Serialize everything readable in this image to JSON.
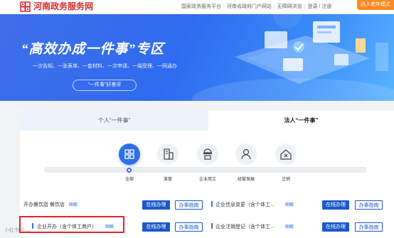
{
  "header": {
    "site_name": "河南政务服务网",
    "links": [
      "国家政务服务平台",
      "河南省政府门户网站",
      "无障碍浏览",
      "登录 / 注册"
    ],
    "elder_mode": "进入老年模式"
  },
  "banner": {
    "title": "“高效办成一件事”专区",
    "subtitle": "一次告知、一张表单、一套材料、一次申请、一端受理、一网通办",
    "rating_button": "“一件事”好差评"
  },
  "tabs": {
    "personal": "个人“一件事”",
    "legal": "法人“一件事”"
  },
  "stages": [
    {
      "label": "全部",
      "icon": "grid-icon",
      "active": true
    },
    {
      "label": "准营",
      "icon": "building-icon",
      "active": false
    },
    {
      "label": "企业用工",
      "icon": "worker-icon",
      "active": false
    },
    {
      "label": "经营发展",
      "icon": "user-growth-icon",
      "active": false
    },
    {
      "label": "注销",
      "icon": "house-cancel-icon",
      "active": false
    }
  ],
  "items": {
    "left_top": {
      "prefix": "开办餐饮店",
      "name": "餐饮店",
      "diagram": "图解",
      "online": "在线办理",
      "guide": "办事指南"
    },
    "left_bottom": {
      "name": "企业开办（含个体工商户）",
      "diagram": "图解",
      "online": "在线办理",
      "guide": "办事指南"
    },
    "right_top": {
      "name": "企业信息变更（含个体工…",
      "diagram": "图解",
      "online": "在线办理",
      "guide": "办事指南"
    },
    "right_bottom": {
      "name": "企业注销登记（含个体工…",
      "diagram": "图解",
      "online": "在线办理",
      "guide": "办事指南"
    }
  },
  "watermark": "小红书号:…",
  "colors": {
    "brand_red": "#d22b2b",
    "primary_blue": "#1b59c9",
    "accent_orange": "#ff8a1f",
    "highlight_red": "#e12525"
  }
}
